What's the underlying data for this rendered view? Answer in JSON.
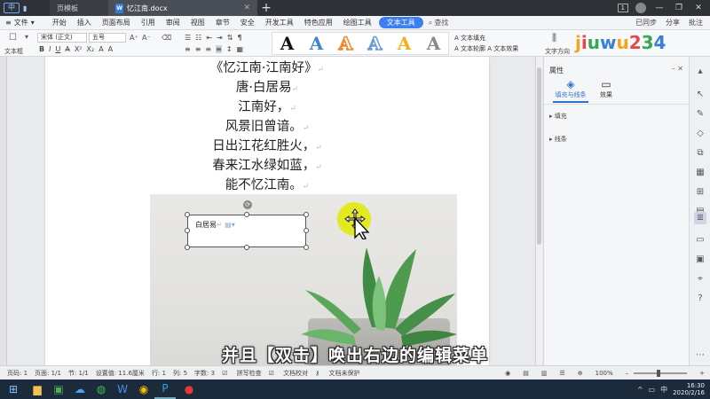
{
  "titlebar": {
    "tab_home_label": "页模板",
    "tab_doc_label": "忆江南.docx",
    "doc_icon_letter": "W",
    "notif_count": "1"
  },
  "menubar": {
    "file_label": "文件",
    "items": [
      "开始",
      "插入",
      "页面布局",
      "引用",
      "审阅",
      "视图",
      "章节",
      "安全",
      "开发工具",
      "特色应用",
      "绘图工具"
    ],
    "active_label": "文本工具",
    "search_label": "查找",
    "right": [
      "已同步",
      "分享",
      "批注"
    ]
  },
  "ribbon": {
    "textbox_label": "文本框",
    "font_name": "宋体 (正文)",
    "font_size": "五号",
    "text_fill_label": "文本填充",
    "text_outline_label": "文本轮廓",
    "text_effect_label": "文本效果",
    "text_direction_label": "文字方向",
    "wordart_letter": "A",
    "wordart_colors": [
      "#111111",
      "#3f86d0",
      "#f08a2c",
      "#6c9ad8",
      "#f2b21b",
      "#888888"
    ],
    "logo_text": "jiuwu234"
  },
  "document": {
    "poem_lines": [
      "《忆江南·江南好》",
      "唐·白居易",
      "江南好，",
      "风景旧曾谙。",
      "日出江花红胜火，",
      "春来江水绿如蓝，",
      "能不忆江南。"
    ],
    "textbox_text": "白居易",
    "subtitle": "并且【双击】唤出右边的编辑菜单"
  },
  "pane": {
    "title": "属性",
    "tab_fill_label": "填充与线条",
    "tab_effect_label": "效果",
    "section_fill": "填充",
    "section_line": "线条"
  },
  "status": {
    "page_no": "页码: 1",
    "page": "页面: 1/1",
    "section": "节: 1/1",
    "setting": "设置值: 11.6厘米",
    "row": "行: 1",
    "col": "列: 5",
    "words": "字数: 3",
    "spell": "拼写检查",
    "proof": "文档校对",
    "protect": "文档未保护",
    "zoom": "100%"
  },
  "taskbar": {
    "ime": "中",
    "time": "16:30",
    "date": "2020/2/16"
  },
  "colors": {
    "accent": "#3d7ff0",
    "highlight": "#e0e800"
  }
}
